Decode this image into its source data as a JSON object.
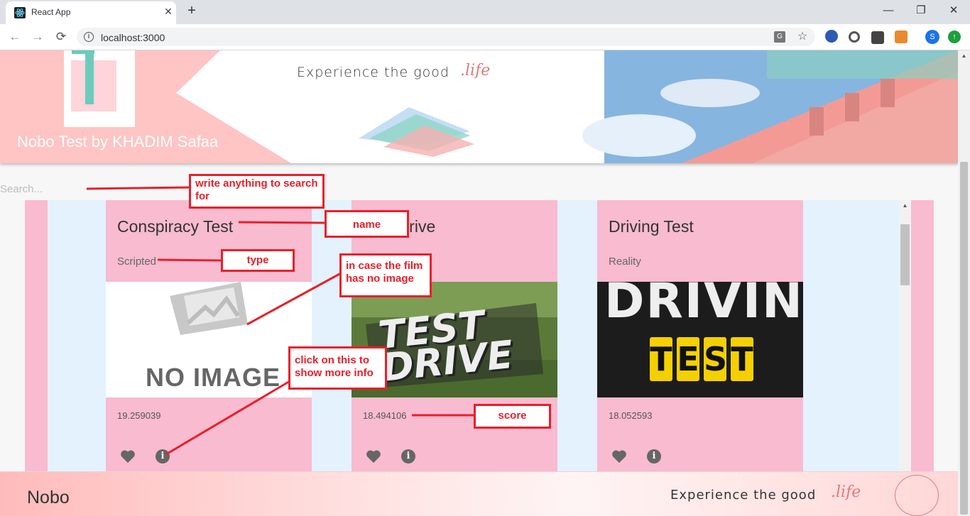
{
  "browser": {
    "tab_title": "React App",
    "tab_close": "✕",
    "new_tab": "+",
    "url": "localhost:3000",
    "window_controls": [
      "—",
      "❐",
      "✕"
    ],
    "nav": {
      "back": "←",
      "forward": "→",
      "reload": "⟳"
    }
  },
  "header": {
    "title": "Nobo Test by KHADIM Safaa",
    "tagline": "Experience the good",
    "tagline_script": ".life"
  },
  "search": {
    "placeholder": "Search..."
  },
  "cards": [
    {
      "name": "Conspiracy Test",
      "type": "Scripted",
      "image": "no-image",
      "image_text": "NO IMAGE",
      "score": "19.259039"
    },
    {
      "name": "Test Drive",
      "type": "",
      "image": "test-drive",
      "image_text": "TEST DRIVE",
      "score": "18.494106"
    },
    {
      "name": "Driving Test",
      "type": "Reality",
      "image": "driving-test",
      "image_text_top": "DRIVING",
      "image_text_bottom": [
        "T",
        "E",
        "S",
        "T"
      ],
      "score": "18.052593"
    }
  ],
  "icons": {
    "favorite": "heart-icon",
    "info": "info-icon"
  },
  "info_glyph": "i",
  "footer": {
    "brand": "Nobo",
    "tagline": "Experience the good",
    "tagline_script": ".life"
  },
  "annotations": {
    "search": "write anything to search for",
    "name": "name",
    "type": "type",
    "no_image": "in case the film has no image",
    "info": "click on this to show more info",
    "score": "score"
  },
  "colors": {
    "card_bg": "#f8bbd0",
    "content_bg": "#e3f2fd",
    "annotation_red": "#e8202a",
    "header_pink": "#ffb3b3"
  }
}
